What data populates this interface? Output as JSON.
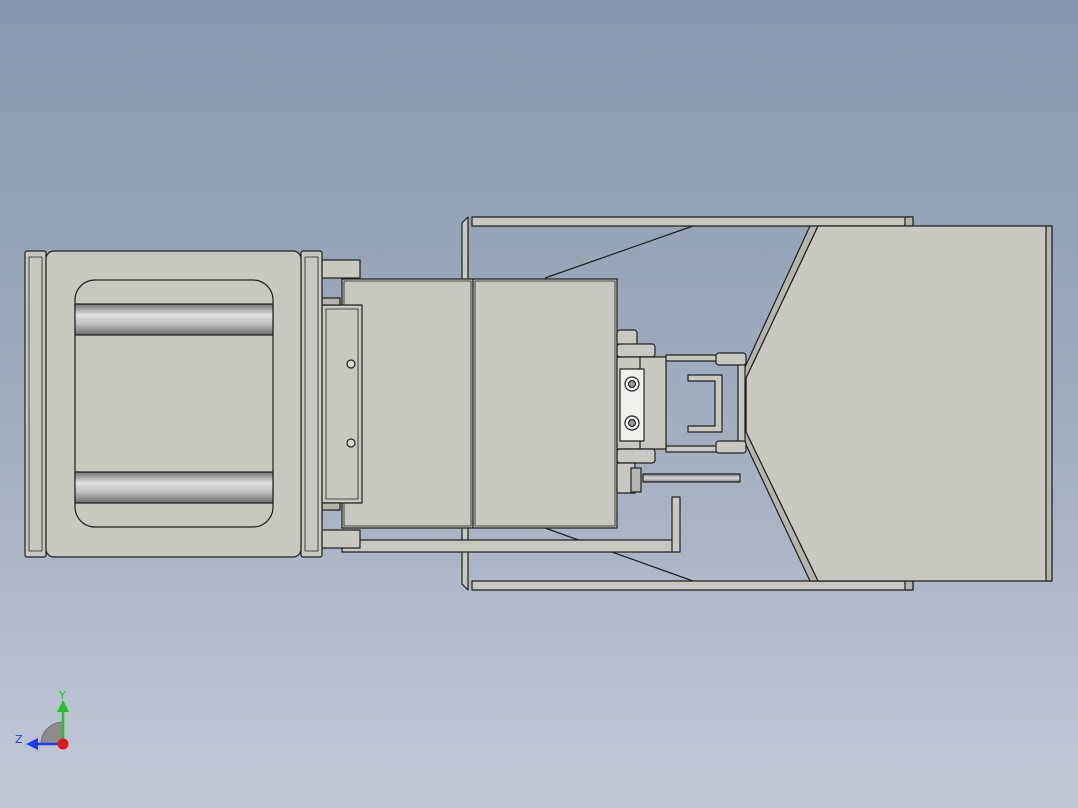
{
  "viewport": {
    "background_top": "#8798ae",
    "background_bottom": "#c2c8d6"
  },
  "model": {
    "part_fill": "#c8c8c0",
    "part_fill_dark": "#b4b4ac",
    "edge_color": "#202020",
    "rod_light": "#d8d8d8",
    "rod_dark": "#707070"
  },
  "triad": {
    "y_label": "Y",
    "z_label": "Z",
    "y_color": "#22c322",
    "z_color": "#1e3cf0",
    "x_color": "#e01818"
  }
}
